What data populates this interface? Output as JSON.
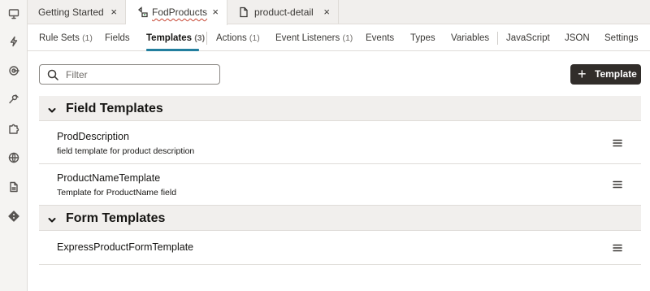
{
  "tabs": [
    {
      "label": "Getting Started",
      "close": "×"
    },
    {
      "label": "FodProducts",
      "close": "×"
    },
    {
      "label": "product-detail",
      "close": "×"
    }
  ],
  "subtabs": [
    {
      "label": "Rule Sets",
      "count": "(1)"
    },
    {
      "label": "Fields",
      "count": ""
    },
    {
      "label": "Templates",
      "count": "(3)"
    },
    {
      "label": "Actions",
      "count": "(1)"
    },
    {
      "label": "Event Listeners",
      "count": "(1)"
    },
    {
      "label": "Events",
      "count": ""
    },
    {
      "label": "Types",
      "count": ""
    },
    {
      "label": "Variables",
      "count": ""
    },
    {
      "label": "JavaScript",
      "count": ""
    },
    {
      "label": "JSON",
      "count": ""
    },
    {
      "label": "Settings",
      "count": ""
    }
  ],
  "toolbar": {
    "filter_placeholder": "Filter",
    "filter_value": "",
    "add_label": "Template",
    "add_icon": "plus-icon"
  },
  "sections": [
    {
      "title": "Field Templates",
      "items": [
        {
          "name": "ProdDescription",
          "description": "field template for product description"
        },
        {
          "name": "ProductNameTemplate",
          "description": "Template for ProductName field"
        }
      ]
    },
    {
      "title": "Form Templates",
      "items": [
        {
          "name": "ExpressProductFormTemplate",
          "description": ""
        }
      ]
    }
  ],
  "rail_icons": [
    "monitor-icon",
    "lightning-icon",
    "circle-target-icon",
    "pin-icon",
    "puzzle-icon",
    "globe-icon",
    "document-icon",
    "git-icon"
  ],
  "colors": {
    "accent": "#227e9e",
    "primary_button": "#312d2a",
    "section_bg": "#f1efed"
  }
}
